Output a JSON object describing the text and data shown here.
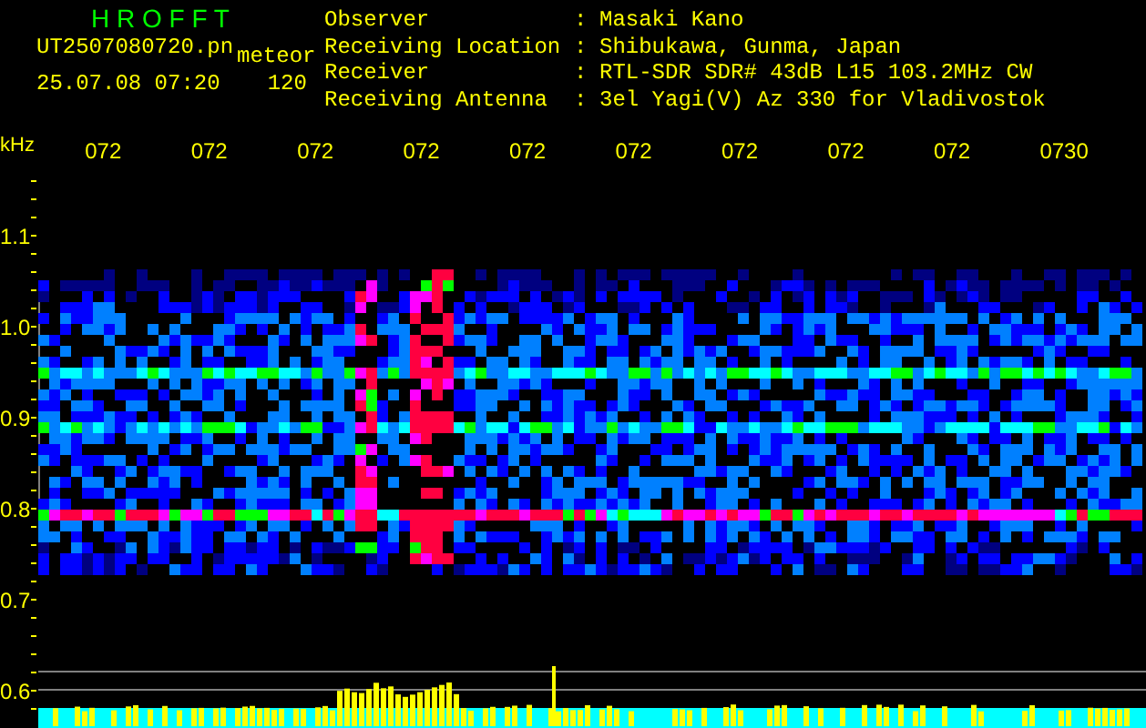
{
  "header": {
    "title": "H R O F F T",
    "file_name": "UT2507080720.pn",
    "type": "meteor",
    "timestamp": "25.07.08 07:20",
    "count": "120"
  },
  "station_info": [
    {
      "label": "Observer",
      "separator": ":",
      "value": "Masaki Kano"
    },
    {
      "label": "Receiving Location",
      "separator": ":",
      "value": "Shibukawa, Gunma, Japan"
    },
    {
      "label": "Receiver",
      "separator": ":",
      "value": "RTL-SDR SDR# 43dB L15 103.2MHz CW"
    },
    {
      "label": "Receiving Antenna",
      "separator": ":",
      "value": "3el Yagi(V) Az 330 for Vladivostok"
    }
  ],
  "time_axis": {
    "labels": [
      "072",
      "072",
      "072",
      "072",
      "072",
      "072",
      "072",
      "072",
      "072",
      "0730"
    ]
  },
  "frequency_axis": {
    "unit": "kHz",
    "labels": [
      "1.1",
      "1.0",
      "0.9",
      "0.8",
      "0.7",
      "0.6"
    ]
  }
}
